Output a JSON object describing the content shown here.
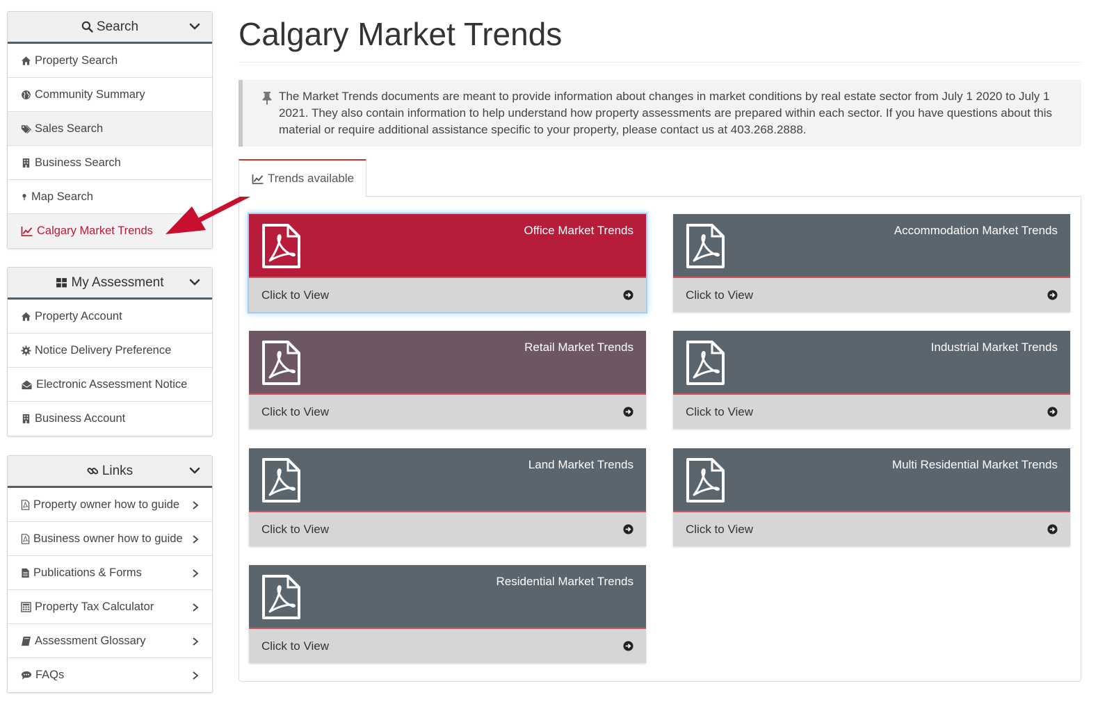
{
  "search_panel": {
    "title": "Search",
    "items": [
      {
        "label": "Property Search",
        "icon": "home-icon"
      },
      {
        "label": "Community Summary",
        "icon": "globe-icon"
      },
      {
        "label": "Sales Search",
        "icon": "tags-icon"
      },
      {
        "label": "Business Search",
        "icon": "building-icon"
      },
      {
        "label": "Map Search",
        "icon": "map-pin-icon"
      },
      {
        "label": "Calgary Market Trends",
        "icon": "line-chart-icon",
        "active": true
      }
    ]
  },
  "assessment_panel": {
    "title": "My Assessment",
    "items": [
      {
        "label": "Property Account",
        "icon": "home-icon"
      },
      {
        "label": "Notice Delivery Preference",
        "icon": "gear-icon"
      },
      {
        "label": "Electronic Assessment Notice",
        "icon": "envelope-open-icon"
      },
      {
        "label": "Business Account",
        "icon": "building-icon"
      }
    ]
  },
  "links_panel": {
    "title": "Links",
    "items": [
      {
        "label": "Property owner how to guide",
        "icon": "pdf-file-icon"
      },
      {
        "label": "Business owner how to guide",
        "icon": "pdf-file-icon"
      },
      {
        "label": "Publications & Forms",
        "icon": "file-text-icon"
      },
      {
        "label": "Property Tax Calculator",
        "icon": "calculator-icon"
      },
      {
        "label": "Assessment Glossary",
        "icon": "book-icon"
      },
      {
        "label": "FAQs",
        "icon": "comments-icon"
      }
    ]
  },
  "main": {
    "title": "Calgary Market Trends",
    "notice": "The Market Trends documents are meant to provide information about changes in market conditions by real estate sector from July 1 2020 to July 1 2021. They also contain information to help understand how property assessments are prepared within each sector. If you have questions about this material or require additional assistance specific to your property, please contact us at 403.268.2888.",
    "tab_label": "Trends available",
    "cards": [
      {
        "title": "Office Market Trends",
        "action": "Click to View",
        "color": "#b71c3a"
      },
      {
        "title": "Accommodation Market Trends",
        "action": "Click to View",
        "color": "#5a656e"
      },
      {
        "title": "Retail Market Trends",
        "action": "Click to View",
        "color": "#6d5764"
      },
      {
        "title": "Industrial Market Trends",
        "action": "Click to View",
        "color": "#5a656e"
      },
      {
        "title": "Land Market Trends",
        "action": "Click to View",
        "color": "#5a656e"
      },
      {
        "title": "Multi Residential Market Trends",
        "action": "Click to View",
        "color": "#5a656e"
      },
      {
        "title": "Residential Market Trends",
        "action": "Click to View",
        "color": "#5a656e"
      }
    ]
  },
  "colors": {
    "accent_red": "#b71c3a",
    "slate": "#5a656e",
    "annotation_arrow": "#c8102e"
  }
}
